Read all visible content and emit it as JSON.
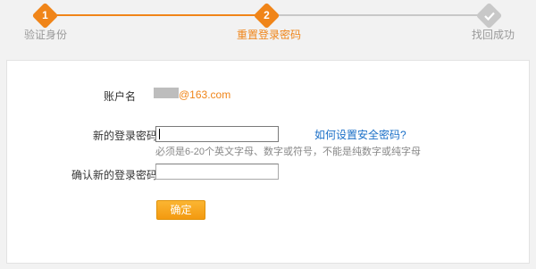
{
  "colors": {
    "accent": "#f08519",
    "done_gray": "#c8c8c8",
    "link": "#1a6fc7",
    "hint": "#888888",
    "button_top": "#fbb532",
    "button_bottom": "#f39a10"
  },
  "steps": [
    {
      "number": "1",
      "label": "验证身份",
      "state": "completed"
    },
    {
      "number": "2",
      "label": "重置登录密码",
      "state": "current"
    },
    {
      "icon": "check-icon",
      "label": "找回成功",
      "state": "pending"
    }
  ],
  "form": {
    "account_label": "账户名",
    "email_domain": "@163.com",
    "new_password_label": "新的登录密码",
    "new_password_value": "",
    "help_link": "如何设置安全密码?",
    "password_hint": "必须是6-20个英文字母、数字或符号，不能是纯数字或纯字母",
    "confirm_label": "确认新的登录密码",
    "confirm_value": "",
    "submit_label": "确定"
  }
}
